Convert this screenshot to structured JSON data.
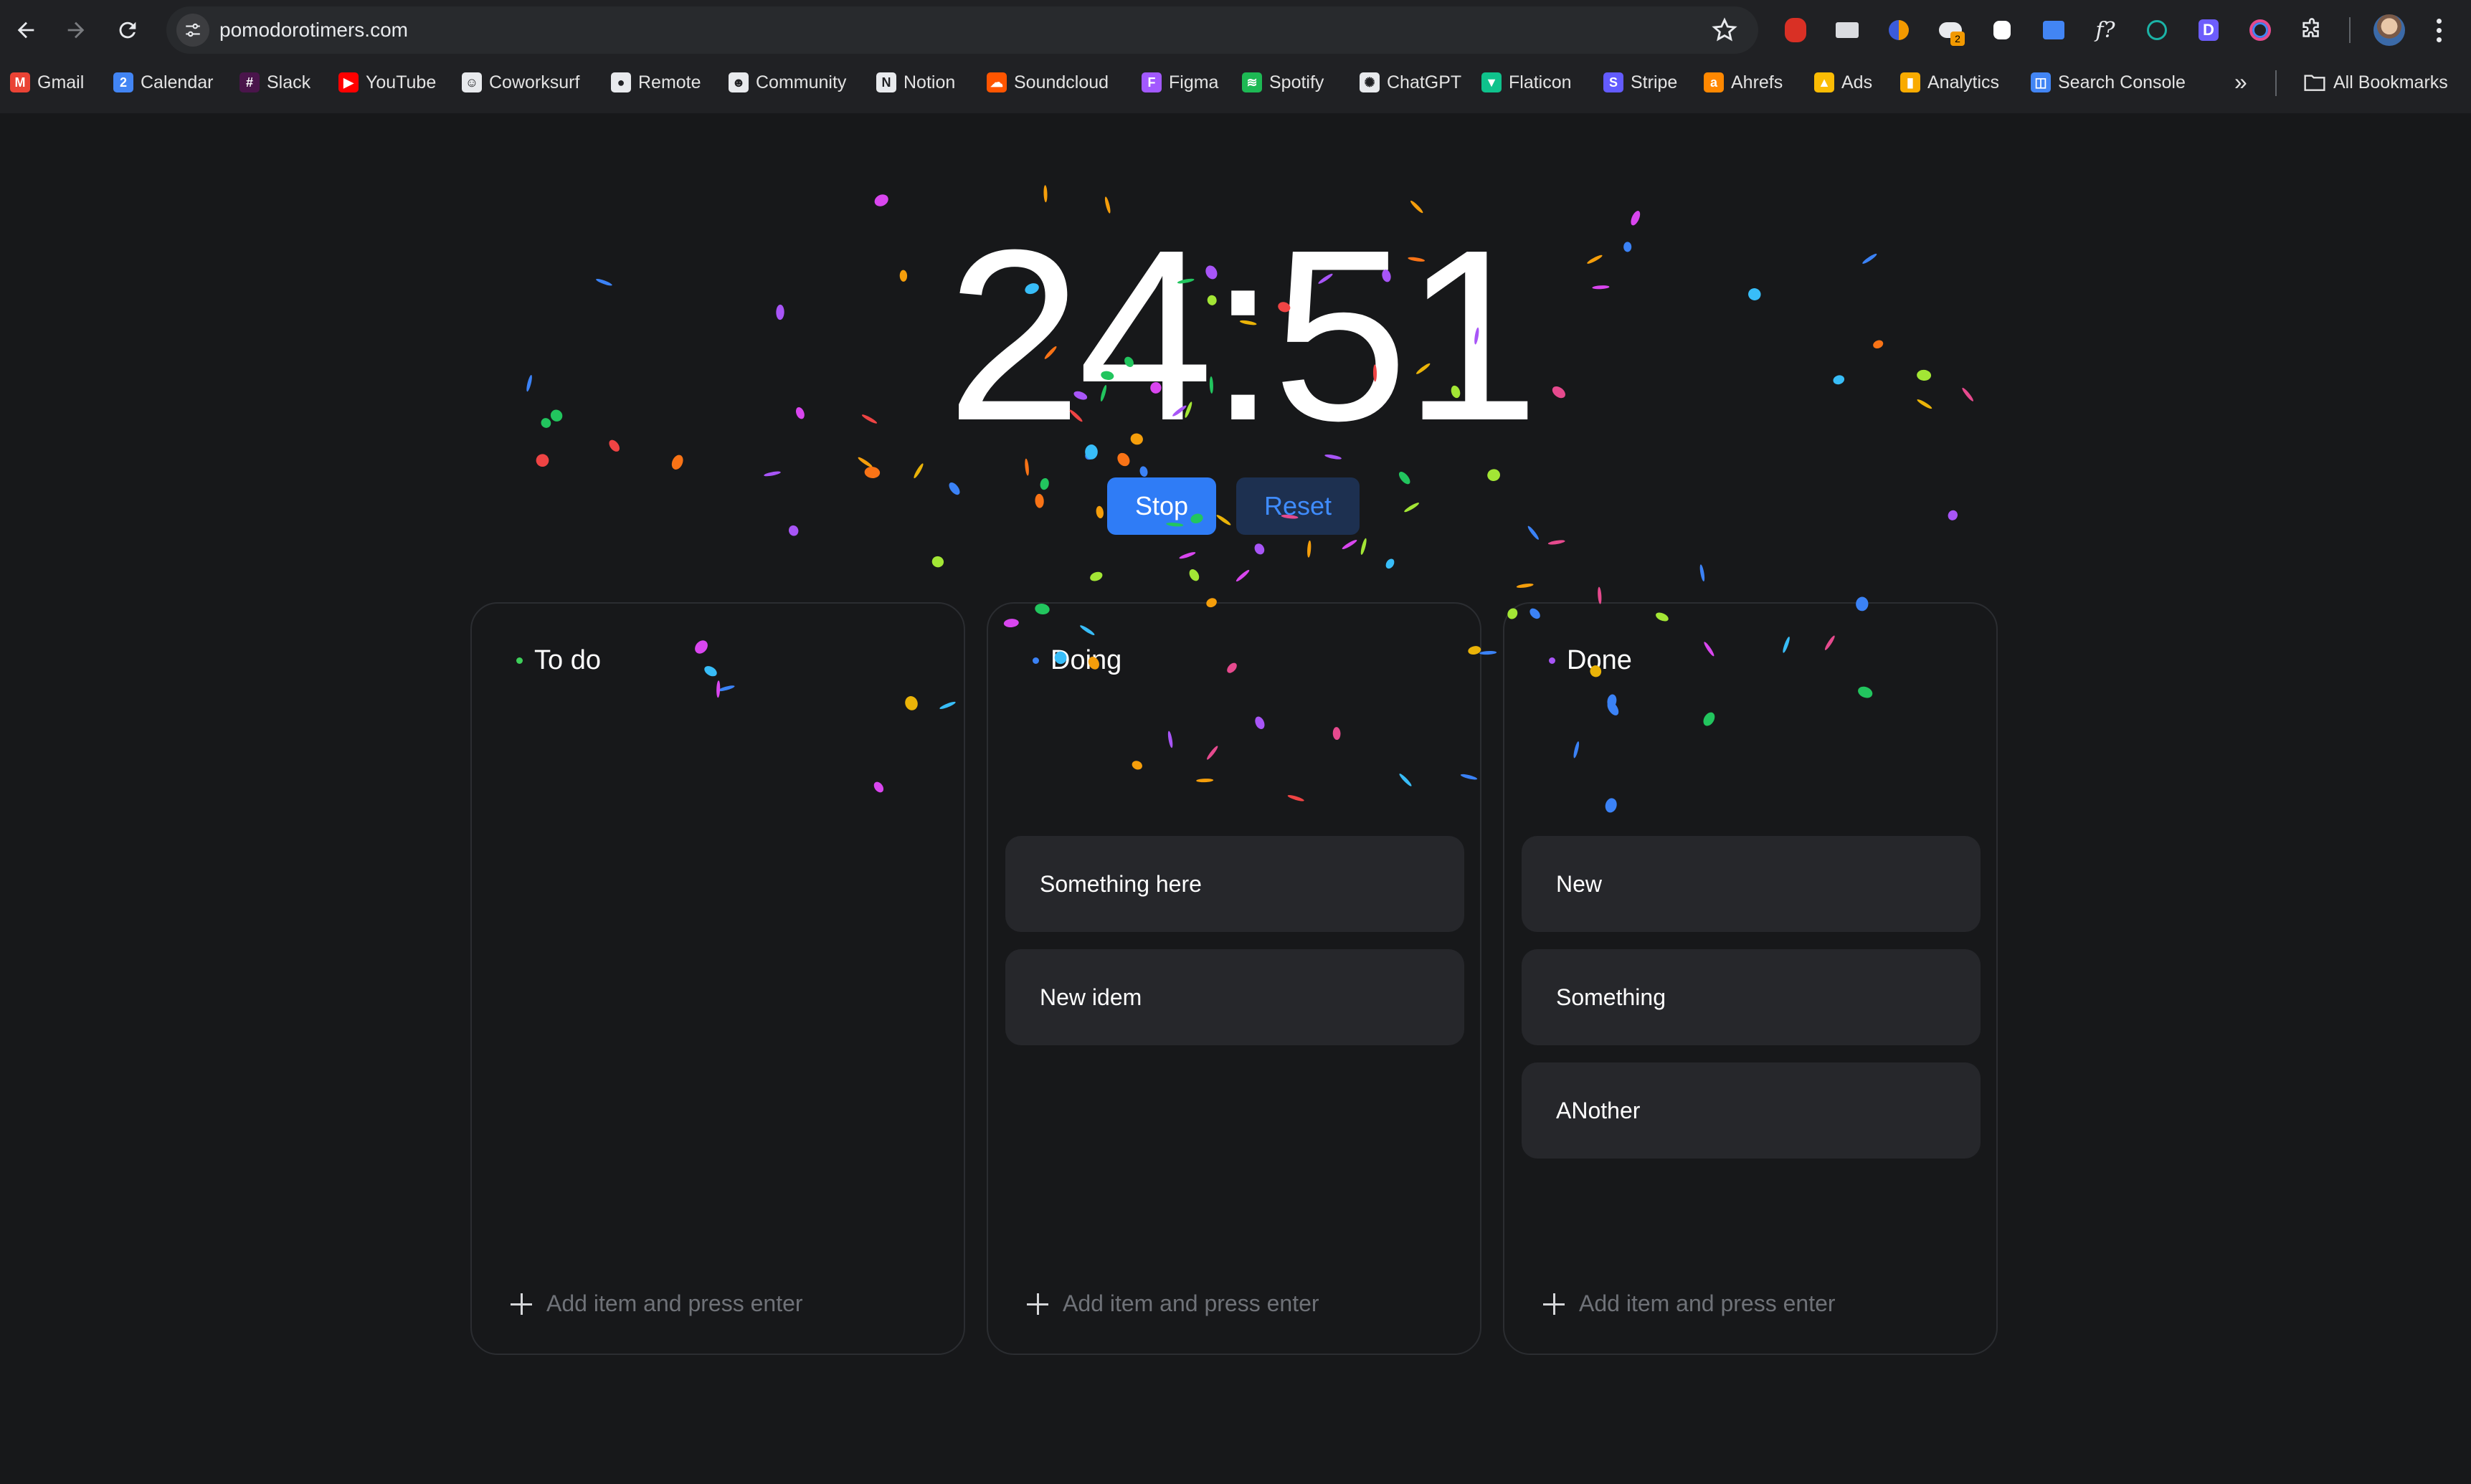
{
  "browser": {
    "url": "pomodorotimers.com",
    "bookmarks": [
      {
        "label": "Gmail",
        "icon": "gmail-icon",
        "color": "#ea4335",
        "glyph": "M"
      },
      {
        "label": "Calendar",
        "icon": "calendar-icon",
        "color": "#4285f4",
        "glyph": "2"
      },
      {
        "label": "Slack",
        "icon": "slack-icon",
        "color": "#4a154b",
        "glyph": "#"
      },
      {
        "label": "YouTube",
        "icon": "youtube-icon",
        "color": "#ff0000",
        "glyph": "▶"
      },
      {
        "label": "Coworksurf",
        "icon": "coworksurf-icon",
        "color": "#e8eaed",
        "glyph": "☺"
      },
      {
        "label": "Remote",
        "icon": "github-icon",
        "color": "#e8eaed",
        "glyph": "●"
      },
      {
        "label": "Community",
        "icon": "community-icon",
        "color": "#e8eaed",
        "glyph": "☻"
      },
      {
        "label": "Notion",
        "icon": "notion-icon",
        "color": "#e8eaed",
        "glyph": "N"
      },
      {
        "label": "Soundcloud",
        "icon": "soundcloud-icon",
        "color": "#ff5500",
        "glyph": "☁"
      },
      {
        "label": "Figma",
        "icon": "figma-icon",
        "color": "#a259ff",
        "glyph": "F"
      },
      {
        "label": "Spotify",
        "icon": "spotify-icon",
        "color": "#1db954",
        "glyph": "≋"
      },
      {
        "label": "ChatGPT",
        "icon": "chatgpt-icon",
        "color": "#e8eaed",
        "glyph": "✺"
      },
      {
        "label": "Flaticon",
        "icon": "flaticon-icon",
        "color": "#0fc28c",
        "glyph": "▼"
      },
      {
        "label": "Stripe",
        "icon": "stripe-icon",
        "color": "#635bff",
        "glyph": "S"
      },
      {
        "label": "Ahrefs",
        "icon": "ahrefs-icon",
        "color": "#ff8800",
        "glyph": "a"
      },
      {
        "label": "Ads",
        "icon": "google-ads-icon",
        "color": "#fbbc04",
        "glyph": "▲"
      },
      {
        "label": "Analytics",
        "icon": "analytics-icon",
        "color": "#f9ab00",
        "glyph": "▮"
      },
      {
        "label": "Search Console",
        "icon": "search-console-icon",
        "color": "#4285f4",
        "glyph": "◫"
      }
    ],
    "all_bookmarks_label": "All Bookmarks",
    "more_bookmarks_glyph": "»"
  },
  "timer": {
    "display": "24:51",
    "stop_label": "Stop",
    "reset_label": "Reset"
  },
  "columns": [
    {
      "title": "To do",
      "bullet_color": "#3ecf5a",
      "items": [],
      "add_placeholder": "Add item and press enter"
    },
    {
      "title": "Doing",
      "bullet_color": "#3b82f6",
      "items": [
        "Something here",
        "New idem"
      ],
      "add_placeholder": "Add item and press enter"
    },
    {
      "title": "Done",
      "bullet_color": "#a855f7",
      "items": [
        "New",
        "Something",
        "ANother"
      ],
      "add_placeholder": "Add item and press enter"
    }
  ],
  "theme": {
    "accent": "#2f7cf6",
    "confetti_colors": [
      "#e64a8e",
      "#d946ef",
      "#a855f7",
      "#3b82f6",
      "#38bdf8",
      "#22c55e",
      "#a3e635",
      "#eab308",
      "#f59e0b",
      "#ef4444",
      "#f97316"
    ]
  }
}
